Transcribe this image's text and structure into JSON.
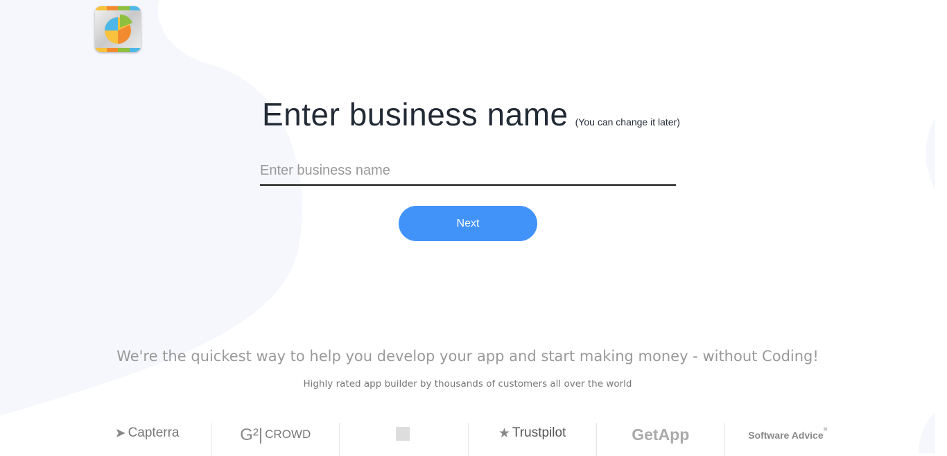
{
  "header": {
    "logo": "app-builder-logo"
  },
  "main": {
    "title": "Enter business name",
    "title_note": "(You can change it later)",
    "input_placeholder": "Enter business name",
    "input_value": "",
    "next_label": "Next"
  },
  "footer": {
    "tagline": "We're the quickest way to help you develop your app and start making money - without Coding!",
    "subtitle": "Highly rated app builder by thousands of customers all over the world",
    "ratings": [
      {
        "name": "Capterra",
        "icon": "capterra-arrow-icon"
      },
      {
        "name": "CROWD",
        "icon": "g2-icon"
      },
      {
        "name": "",
        "icon": "review-site-icon"
      },
      {
        "name": "Trustpilot",
        "icon": "star-icon"
      },
      {
        "name": "GetApp",
        "icon": "getapp-icon"
      },
      {
        "name": "Software Advice",
        "icon": "chat-bubble-icon"
      }
    ]
  },
  "colors": {
    "accent": "#4193f9",
    "blob": "#f5f7fd"
  }
}
